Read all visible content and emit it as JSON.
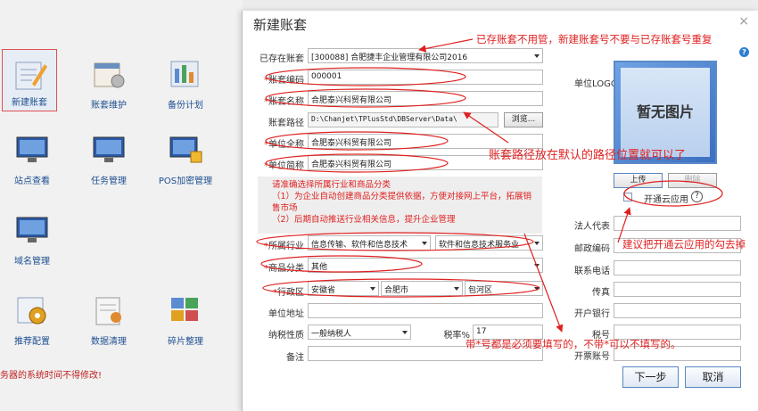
{
  "launcher": {
    "tiles": [
      {
        "label": "新建账套"
      },
      {
        "label": "账套维护"
      },
      {
        "label": "备份计划"
      },
      {
        "label": "站点查看"
      },
      {
        "label": "任务管理"
      },
      {
        "label": "POS加密管理"
      },
      {
        "label": "域名管理"
      },
      {
        "label": "推荐配置"
      },
      {
        "label": "数据清理"
      },
      {
        "label": "碎片整理"
      }
    ],
    "warning": "务器的系统时间不得修改!"
  },
  "dialog": {
    "title": "新建账套",
    "close_glyph": "×",
    "help_glyph": "?",
    "existing_label": "已存在账套",
    "existing_value": "[300088] 合肥捷丰企业管理有限公司2016",
    "code_label": "账套编码",
    "code_value": "000001",
    "name_label": "账套名称",
    "name_value": "合肥泰兴科贸有限公司",
    "path_label": "账套路径",
    "path_value": "D:\\Chanjet\\TPlusStd\\DBServer\\Data\\",
    "browse_label": "浏览...",
    "fullname_label": "单位全称",
    "fullname_value": "合肥泰兴科贸有限公司",
    "shortname_label": "单位简称",
    "shortname_value": "合肥泰兴科贸有限公司",
    "tip": {
      "line1": "请准确选择所属行业和商品分类",
      "line2": "（1）为企业自动创建商品分类提供依据，方便对接网上平台，拓展销",
      "line3": "售市场",
      "line4": "（2）后期自动推送行业相关信息，提升企业管理"
    },
    "industry_label": "所属行业",
    "industry_value1": "信息传输、软件和信息技术",
    "industry_value2": "软件和信息技术服务业",
    "goods_label": "商品分类",
    "goods_value": "其他",
    "region_label": "行政区",
    "province": "安徽省",
    "city": "合肥市",
    "district": "包河区",
    "address_label": "单位地址",
    "taxpayer_label": "纳税性质",
    "taxpayer_value": "一般纳税人",
    "taxrate_label": "税率%",
    "taxrate_value": "17",
    "note_label": "备注",
    "logo_label": "单位LOGO",
    "logo_placeholder": "暂无图片",
    "upload_label": "上传",
    "delete_label": "删除",
    "cloud_label": "开通云应用",
    "legal_label": "法人代表",
    "postcode_label": "邮政编码",
    "phone_label": "联系电话",
    "fax_label": "传真",
    "bank_label": "开户银行",
    "taxno_label": "税号",
    "invoice_label": "开票账号",
    "next_label": "下一步",
    "cancel_label": "取消"
  },
  "annotations": {
    "a1": "已存账套不用管，新建账套号不要与已存账套号重复",
    "a2": "账套路径放在默认的路径位置就可以了",
    "a3": "建议把开通云应用的勾去掉",
    "a4": "带*号都是必须要填写的，不带*可以不填写的。"
  },
  "colors": {
    "annotation": "#e02020",
    "accent": "#2f7fd0"
  }
}
